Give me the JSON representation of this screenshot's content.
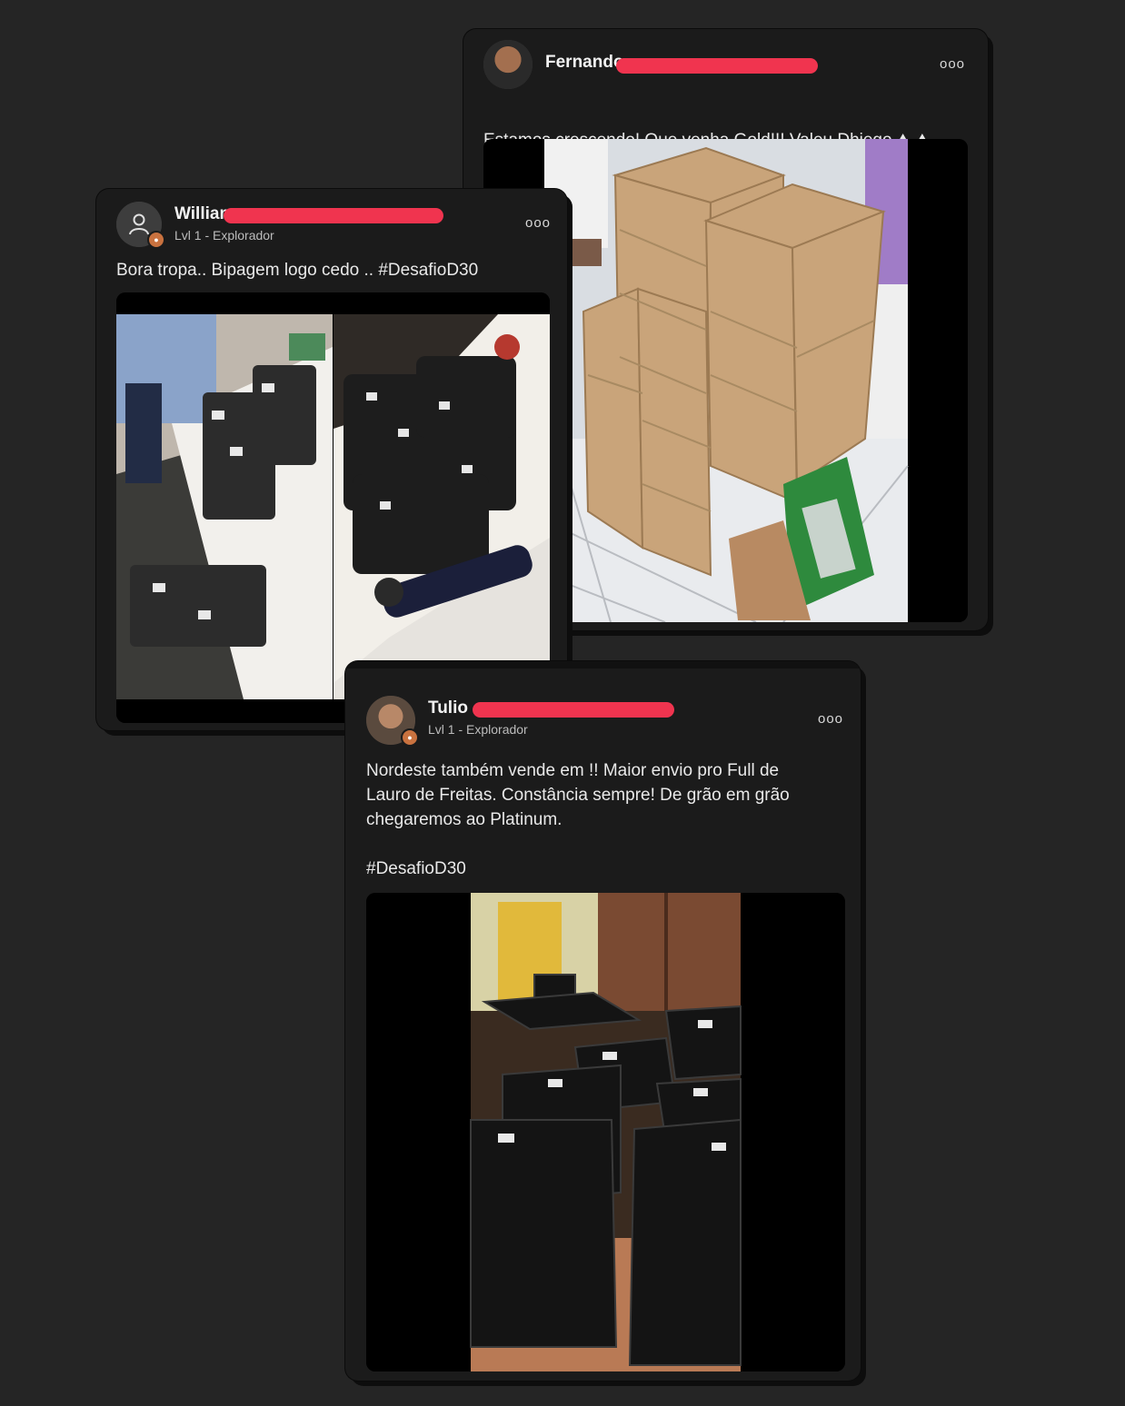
{
  "posts": [
    {
      "author": "Fernando",
      "text": "Estamos crescendo! Que venha Gold!!! Valeu Dhiego",
      "emoji_icons": [
        "mountain-icon",
        "mountain-icon"
      ],
      "more_label": "ooo"
    },
    {
      "author": "William",
      "level": "Lvl 1 - Explorador",
      "text": "Bora tropa.. Bipagem logo cedo .. #DesafioD30",
      "more_label": "ooo"
    },
    {
      "author": "Tulio",
      "level": "Lvl 1 - Explorador",
      "text": "Nordeste também vende em !! Maior envio pro Full de\nLauro de Freitas. Constância sempre!  De grão em grão\nchegaremos ao Platinum.\n\n#DesafioD30",
      "more_label": "ooo"
    }
  ],
  "colors": {
    "background": "#252525",
    "card": "#1b1b1b",
    "redaction": "#f0344f",
    "level_badge": "#c9723f"
  }
}
